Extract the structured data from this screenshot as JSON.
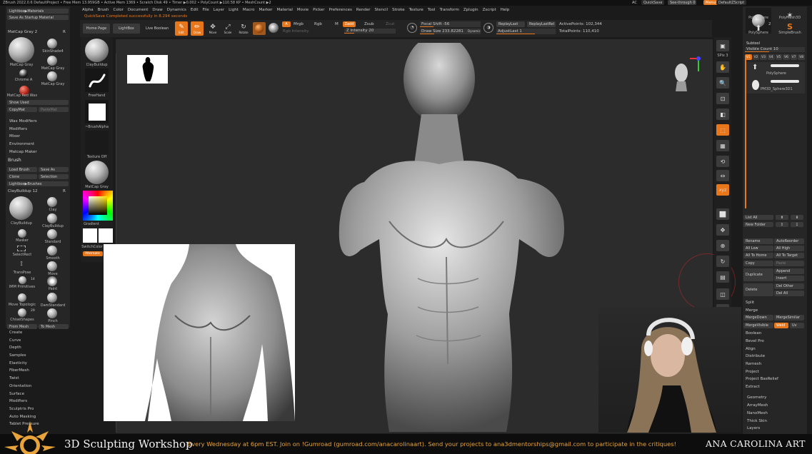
{
  "titlebar": {
    "text": "ZBrush 2022.0.6   DefaultProject  • Free Mem 13.959GB • Active Mem 1369 • Scratch Disk 49 • Timer ▶0.002 • PolyCount ▶110.58 KP • MeshCount ▶2",
    "ac": "AC",
    "quicksave": "QuickSave",
    "see_through": "See-through  0",
    "menus": "Menus",
    "default_script": "DefaultZScript"
  },
  "menubar": [
    "Alpha",
    "Brush",
    "Color",
    "Document",
    "Draw",
    "Dynamics",
    "Edit",
    "File",
    "Layer",
    "Light",
    "Macro",
    "Marker",
    "Material",
    "Movie",
    "Picker",
    "Preferences",
    "Render",
    "Stencil",
    "Stroke",
    "Texture",
    "Tool",
    "Transform",
    "Zplugin",
    "Zscript",
    "Help"
  ],
  "notification": "QuickSave Completed successfully in 8.294 seconds",
  "left_top": {
    "lightbox_materials": "Lightbox▶Materials",
    "save_startup": "Save As Startup Material",
    "matcap_header": "MatCap Gray  2",
    "matcap_r": "R",
    "materials": [
      {
        "label": "MatCap Gray"
      },
      {
        "label": "SkinShade4"
      },
      {
        "label": "MatCap Gray"
      },
      {
        "label": "Chrome A"
      },
      {
        "label": "MatCap Gray"
      },
      {
        "label": "MatCap Red Wax"
      }
    ],
    "show_used": "Show Used",
    "copy_mat": "CopyMat",
    "paste_mat": "PasteMat",
    "sections": [
      "Wax Modifiers",
      "Modifiers",
      "Mixer",
      "Environment",
      "Matcap Maker"
    ]
  },
  "brush": {
    "title": "Brush",
    "load": "Load Brush",
    "save_as": "Save As",
    "clone": "Clone",
    "selection": "Selection",
    "lightbox_brushes": "Lightbox▶Brushes",
    "current": "ClayBuildup  12",
    "current_r": "R",
    "items": [
      {
        "label": "ClayBuildup"
      },
      {
        "label": "Clay"
      },
      {
        "label": "ClayBuildup"
      },
      {
        "label": "Masker"
      },
      {
        "label": "Standard"
      },
      {
        "label": "SelectRect"
      },
      {
        "label": "Smooth"
      },
      {
        "label": "TransPose"
      },
      {
        "label": "Move"
      },
      {
        "label": "IMM Primitives"
      },
      {
        "label": "Paint"
      },
      {
        "label": "Move Topologic"
      },
      {
        "label": "DamStandard"
      },
      {
        "label": "ChiselShapes"
      },
      {
        "label": "Pinch"
      }
    ],
    "count_14": "14",
    "count_29": "29",
    "from_mesh": "From Mesh",
    "to_mesh": "To Mesh",
    "sections": [
      "Create",
      "Curve",
      "Depth",
      "Samples",
      "Elasticity",
      "FiberMesh",
      "Twist",
      "Orientation",
      "Surface",
      "Modifiers",
      "Sculptris Pro",
      "Auto Masking",
      "Tablet Pressure"
    ]
  },
  "shelf": {
    "home_page": "Home Page",
    "lightbox": "LightBox",
    "live_boolean": "Live Boolean",
    "edit": "Edit",
    "draw": "Draw",
    "move": "Move",
    "scale": "Scale",
    "rotate": "Rotate",
    "a": "A",
    "mrgb": "Mrgb",
    "rgb": "Rgb",
    "m": "M",
    "zadd": "Zadd",
    "zsub": "Zsub",
    "zcut": "Zcut",
    "rgb_intensity": "Rgb Intensity",
    "z_intensity": "Z Intensity 20",
    "focal_shift": "Focal Shift -56",
    "draw_size": "Draw Size 233.82281",
    "dynamic": "Dynamic",
    "replay_last": "ReplayLast",
    "replay_last_rel": "ReplayLastRel",
    "adjust_last": "AdjustLast  1",
    "active_points": "ActivePoints: 102,344",
    "total_points": "TotalPoints: 110,410"
  },
  "left_shelf": {
    "clay_buildup": "ClayBuildup",
    "freehand": "FreeHand",
    "brush_alpha": "~BrushAlpha",
    "texture_off": "Texture Off",
    "matcap_gray": "MatCap Gray",
    "gradient": "Gradient",
    "switch_color": "SwitchColor",
    "alternate": "Alternate"
  },
  "right_tool": {
    "polysphere": "PolySphere",
    "polymesh3d": "PolyMesh3D",
    "num_2": "2",
    "simple_brush": "SimpleBrush",
    "subtool": "Subtool",
    "visible_count": "Visible Count  10",
    "vtabs": [
      "V1",
      "V2",
      "V3",
      "V4",
      "V5",
      "V6",
      "V7",
      "V8"
    ],
    "subtools": [
      {
        "label": "PolySphere"
      },
      {
        "label": "PM3D_Sphere3D1"
      }
    ],
    "list_all": "List All",
    "new_folder": "New Folder",
    "rename": "Rename",
    "auto_reorder": "AutoReorder",
    "all_low": "All Low",
    "all_high": "All High",
    "all_to_home": "All To Home",
    "all_to_target": "All To Target",
    "copy": "Copy",
    "paste": "Paste",
    "duplicate": "Duplicate",
    "append": "Append",
    "insert": "Insert",
    "delete": "Delete",
    "del_other": "Del Other",
    "del_all": "Del All",
    "split": "Split",
    "merge": "Merge",
    "merge_down": "MergeDown",
    "merge_similar": "MergeSimilar",
    "merge_visible": "MergeVisible",
    "weld": "Weld",
    "uv": "Uv",
    "boolean": "Boolean",
    "bevel_pro": "Bevel Pro",
    "align": "Align",
    "distribute": "Distribute",
    "remesh": "Remesh",
    "project": "Project",
    "project_bas_relief": "Project BasRelief",
    "extract": "Extract",
    "sections": [
      "Geometry",
      "ArrayMesh",
      "NanoMesh",
      "Thick Skin",
      "Layers"
    ]
  },
  "nav_icons": [
    {
      "name": "bpr-icon",
      "label": "BPR"
    },
    {
      "name": "spix-icon",
      "label": "SPix 3"
    },
    {
      "name": "scroll-icon",
      "label": "Scroll"
    },
    {
      "name": "zoom-icon",
      "label": "Zoom"
    },
    {
      "name": "actual-icon",
      "label": "Actual"
    },
    {
      "name": "aahalf-icon",
      "label": "AAHalf"
    },
    {
      "name": "persp-icon",
      "label": "Persp"
    },
    {
      "name": "floor-icon",
      "label": "Floor"
    },
    {
      "name": "local-icon",
      "label": "L.Sym"
    },
    {
      "name": "gxyz-icon",
      "label": "Gxyz"
    },
    {
      "name": "frame-icon",
      "label": "Frame"
    },
    {
      "name": "move-view-icon",
      "label": "Move"
    },
    {
      "name": "zoom3d-icon",
      "label": "Zoom3D"
    },
    {
      "name": "rotate-view-icon",
      "label": "RotaTe"
    },
    {
      "name": "line-fill-icon",
      "label": "Line Fill PolyF"
    },
    {
      "name": "transp-icon",
      "label": "Transp"
    },
    {
      "name": "ghost-icon",
      "label": "Ghost"
    },
    {
      "name": "solo-icon",
      "label": "Solo"
    },
    {
      "name": "xpose-icon",
      "label": "Xpose"
    }
  ],
  "banner": {
    "title": "3D Sculpting Workshop",
    "message": "Every Wednesday at 6pm EST. Join on !Gumroad (gumroad.com/anacarolinaart). Send your projects to ana3dmentorships@gmail.com to participate in the critiques!",
    "brand": "ANA CAROLINA ART"
  },
  "colors": {
    "orange": "#e8771c",
    "ui_bg": "#1b1b1b",
    "panel": "#2a2a2a",
    "canvas": "#2b2b2b",
    "banner_text": "#e8a33b"
  }
}
